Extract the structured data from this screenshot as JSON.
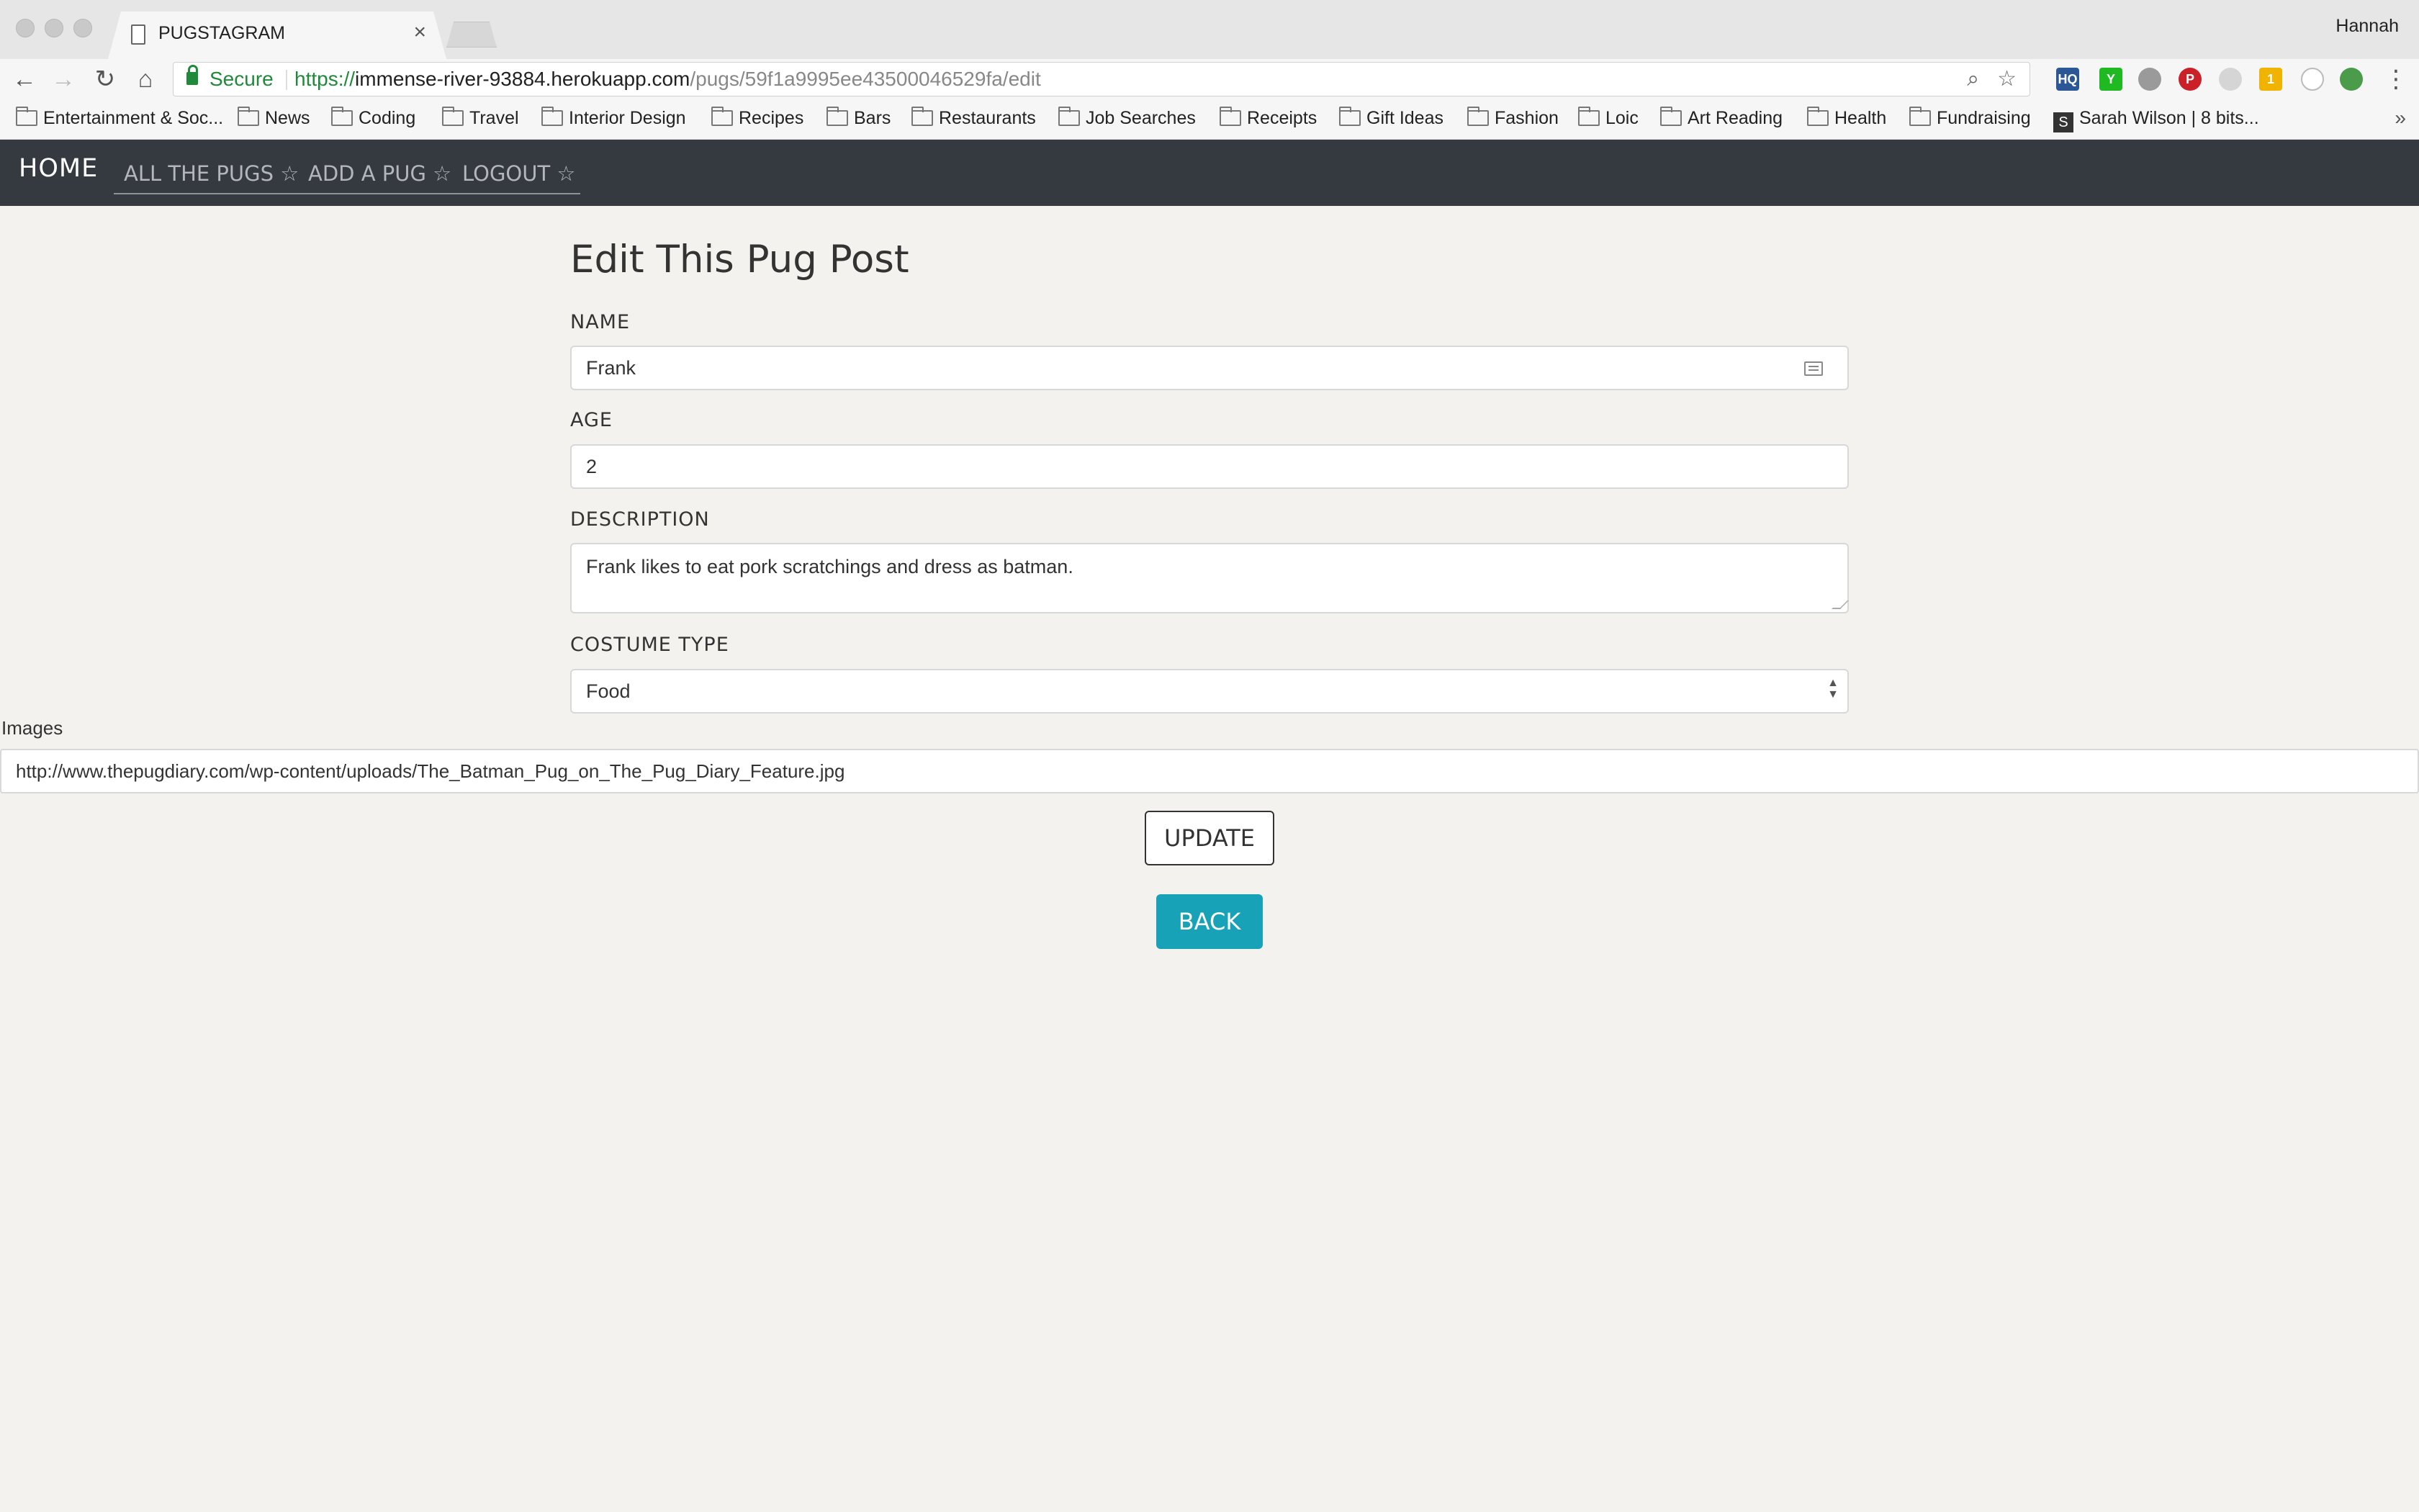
{
  "browser": {
    "tab_title": "PUGSTAGRAM",
    "tab_close": "×",
    "profile_name": "Hannah",
    "secure_label": "Secure",
    "url_scheme": "https://",
    "url_host": "immense-river-93884.herokuapp.com",
    "url_path": "/pugs/59f1a9995ee43500046529fa/edit",
    "bookmarks": [
      "Entertainment & Soc...",
      "News",
      "Coding",
      "Travel",
      "Interior Design",
      "Recipes",
      "Bars",
      "Restaurants",
      "Job Searches",
      "Receipts",
      "Gift Ideas",
      "Fashion",
      "Loic",
      "Art Reading",
      "Health",
      "Fundraising",
      "Sarah Wilson | 8 bits..."
    ],
    "bookmarks_more": "»",
    "extensions": [
      "cloudHQ",
      "Y",
      "bug",
      "pinterest",
      "drop",
      "badge-1",
      "circle",
      "chrome"
    ]
  },
  "navbar": {
    "brand": "HOME",
    "links": [
      "ALL THE PUGS ☆",
      "ADD A PUG ☆",
      "LOGOUT ☆"
    ]
  },
  "form": {
    "heading": "Edit This Pug Post",
    "name_label": "NAME",
    "name_value": "Frank",
    "age_label": "AGE",
    "age_value": "2",
    "description_label": "DESCRIPTION",
    "description_value": "Frank likes to eat pork scratchings and dress as batman.",
    "costume_label": "COSTUME TYPE",
    "costume_value": "Food",
    "images_label": "Images",
    "images_value": "http://www.thepugdiary.com/wp-content/uploads/The_Batman_Pug_on_The_Pug_Diary_Feature.jpg",
    "update_label": "UPDATE",
    "back_label": "BACK"
  },
  "colors": {
    "page_bg": "#f3f2ee",
    "navbar_bg": "#343a40",
    "back_button": "#17a2b8",
    "secure_green": "#1e8a3a"
  }
}
